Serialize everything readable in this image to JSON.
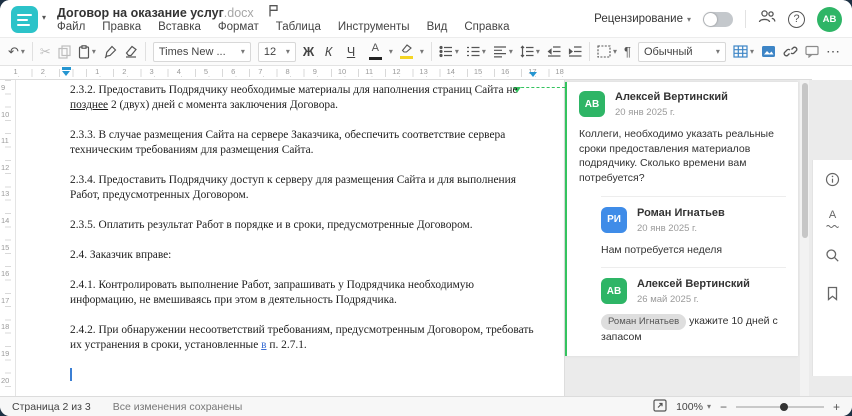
{
  "header": {
    "title": "Договор на оказание услуг",
    "title_ext": ".docx",
    "menu": [
      "Файл",
      "Правка",
      "Вставка",
      "Формат",
      "Таблица",
      "Инструменты",
      "Вид",
      "Справка"
    ],
    "review_label": "Рецензирование",
    "user_initials": "АВ"
  },
  "toolbar": {
    "undo": "↶",
    "cut": "✂",
    "font_name": "Times New ...",
    "font_size": "12",
    "bold": "Ж",
    "italic": "К",
    "underline": "Ч",
    "font_color_letter": "А",
    "style_name": "Обычный",
    "pilcrow": "¶",
    "more": "⋯"
  },
  "ruler": {
    "h_numbers_left": [
      "2",
      "1"
    ],
    "h_numbers_right": [
      "1",
      "2",
      "3",
      "4",
      "5",
      "6",
      "7",
      "8",
      "9",
      "10",
      "11",
      "12",
      "13",
      "14",
      "15",
      "16",
      "17",
      "18"
    ],
    "v_numbers": [
      "9",
      "10",
      "11",
      "12",
      "13",
      "14",
      "15",
      "16",
      "17",
      "18",
      "19",
      "20"
    ]
  },
  "document": {
    "paragraphs": [
      {
        "segments": [
          {
            "t": "2.3.2. Предоставить Подрядчику необходимые материалы для наполнения страниц Сайта не "
          },
          {
            "t": "позднее",
            "s": "u"
          },
          {
            "t": " 2 (двух) дней с момента заключения Договора."
          }
        ]
      },
      {
        "segments": [
          {
            "t": "2.3.3. В случае размещения Сайта на сервере Заказчика, обеспечить соответствие сервера техническим требованиям для размещения Сайта."
          }
        ]
      },
      {
        "segments": [
          {
            "t": "2.3.4. Предоставить Подрядчику доступ к серверу для размещения Сайта и для выполнения Работ, предусмотренных Договором."
          }
        ]
      },
      {
        "segments": [
          {
            "t": "2.3.5. Оплатить результат Работ в порядке и в сроки, предусмотренные Договором."
          }
        ]
      },
      {
        "segments": [
          {
            "t": "2.4. Заказчик вправе:"
          }
        ]
      },
      {
        "segments": [
          {
            "t": "2.4.1. Контролировать выполнение Работ, запрашивать у Подрядчика необходимую информацию, не вмешиваясь при этом в деятельность Подрядчика."
          }
        ]
      },
      {
        "segments": [
          {
            "t": "2.4.2. При обнаружении несоответствий требованиям, предусмотренным Договором, требовать их устранения в сроки, установленные "
          },
          {
            "t": "в",
            "s": "link"
          },
          {
            "t": " п. 2.7.1."
          }
        ]
      },
      {
        "segments": [],
        "cursor": true
      }
    ]
  },
  "comments": {
    "items": [
      {
        "initials": "АВ",
        "avatar_color": "#2eb566",
        "name": "Алексей Вертинский",
        "date": "20 янв 2025 г.",
        "text": "Коллеги, необходимо указать реальные сроки предоставления материалов подрядчику. Сколько времени вам потребуется?",
        "reply": false
      },
      {
        "initials": "РИ",
        "avatar_color": "#3f8ce8",
        "name": "Роман Игнатьев",
        "date": "20 янв 2025 г.",
        "text": "Нам потребуется неделя",
        "reply": true
      },
      {
        "initials": "АВ",
        "avatar_color": "#2eb566",
        "name": "Алексей Вертинский",
        "date": "26 май 2025 г.",
        "mention": "Роман Игнатьев",
        "text": "укажите 10 дней с запасом",
        "reply": true
      }
    ]
  },
  "statusbar": {
    "page_label": "Страница 2 из 3",
    "saved_label": "Все изменения сохранены",
    "zoom_value": "100%",
    "zoom_out": "−",
    "zoom_in": "+"
  },
  "colors": {
    "accent_teal": "#2cc3c9",
    "comment_green": "#34c35f",
    "avatar_green": "#2eb566",
    "avatar_blue": "#3f8ce8",
    "ruler_marker_blue": "#2596d1"
  }
}
